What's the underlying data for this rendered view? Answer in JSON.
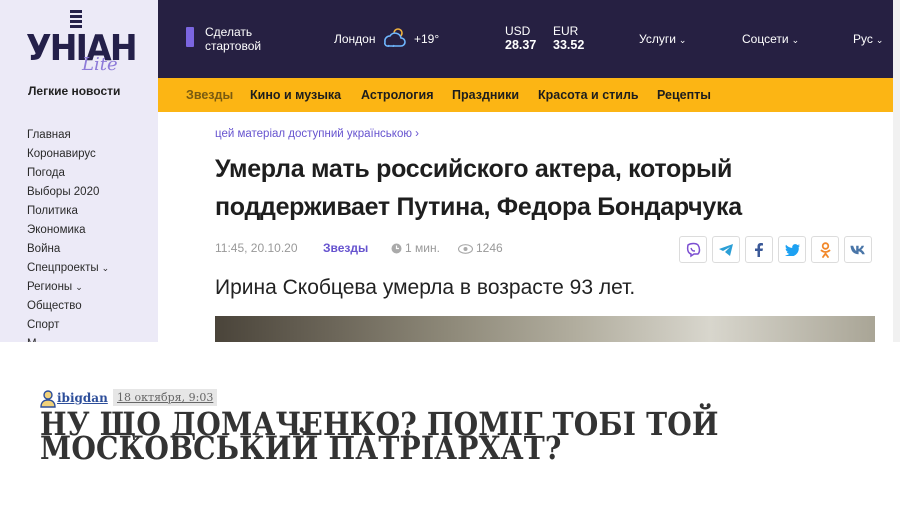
{
  "site": {
    "logo_text": "УНІАН",
    "logo_sub": "Lite",
    "tagline": "Легкие новости"
  },
  "sidebar": {
    "items": [
      {
        "label": "Главная"
      },
      {
        "label": "Коронавирус"
      },
      {
        "label": "Погода"
      },
      {
        "label": "Выборы 2020"
      },
      {
        "label": "Политика"
      },
      {
        "label": "Экономика"
      },
      {
        "label": "Война"
      },
      {
        "label": "Спецпроекты",
        "chevron": "⌄"
      },
      {
        "label": "Регионы",
        "chevron": "⌄"
      },
      {
        "label": "Общество"
      },
      {
        "label": "Спорт"
      },
      {
        "label": "М"
      }
    ]
  },
  "topbar": {
    "start_page": "Сделать стартовой",
    "city": "Лондон",
    "weather_icon": "cloud-sun-icon",
    "temperature": "+19°",
    "usd_label": "USD",
    "usd_value": "28.37",
    "eur_label": "EUR",
    "eur_value": "33.52",
    "services": "Услуги",
    "social": "Соцсети",
    "lang": "Рус",
    "chevron": "⌄"
  },
  "categories": [
    {
      "label": "Звезды",
      "active": true
    },
    {
      "label": "Кино и музыка"
    },
    {
      "label": "Астрология"
    },
    {
      "label": "Праздники"
    },
    {
      "label": "Красота и стиль"
    },
    {
      "label": "Рецепты"
    }
  ],
  "article": {
    "available_ua": "цей матеріал доступний українською ›",
    "headline": "Умерла мать российского актера, который поддерживает Путина, Федора Бондарчука",
    "datetime": "11:45, 20.10.20",
    "category": "Звезды",
    "read_time": "1 мин.",
    "views": "1246",
    "lead": "Ирина Скобцева умерла в возрасте 93 лет.",
    "share_icons": [
      "viber-icon",
      "telegram-icon",
      "facebook-icon",
      "twitter-icon",
      "odnoklassniki-icon",
      "vk-icon"
    ]
  },
  "colors": {
    "topbar": "#262042",
    "catbar": "#fcb514",
    "accent": "#6653cf",
    "sidebar": "#eceaf7"
  },
  "post": {
    "author": "ibigdan",
    "date": "18 октября, 9:03",
    "title": "НУ ЩО ДОМАЧЕНКО? ПОМІГ ТОБІ ТОЙ МОСКОВСЬКИЙ ПАТРІАРХАТ?"
  }
}
